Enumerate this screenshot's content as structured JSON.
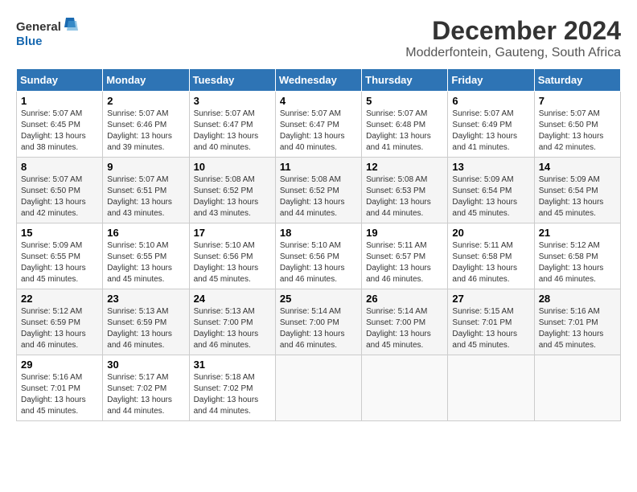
{
  "logo": {
    "line1": "General",
    "line2": "Blue"
  },
  "title": {
    "month_year": "December 2024",
    "location": "Modderfontein, Gauteng, South Africa"
  },
  "weekdays": [
    "Sunday",
    "Monday",
    "Tuesday",
    "Wednesday",
    "Thursday",
    "Friday",
    "Saturday"
  ],
  "weeks": [
    [
      {
        "day": "1",
        "sunrise": "5:07 AM",
        "sunset": "6:45 PM",
        "daylight": "13 hours and 38 minutes."
      },
      {
        "day": "2",
        "sunrise": "5:07 AM",
        "sunset": "6:46 PM",
        "daylight": "13 hours and 39 minutes."
      },
      {
        "day": "3",
        "sunrise": "5:07 AM",
        "sunset": "6:47 PM",
        "daylight": "13 hours and 40 minutes."
      },
      {
        "day": "4",
        "sunrise": "5:07 AM",
        "sunset": "6:47 PM",
        "daylight": "13 hours and 40 minutes."
      },
      {
        "day": "5",
        "sunrise": "5:07 AM",
        "sunset": "6:48 PM",
        "daylight": "13 hours and 41 minutes."
      },
      {
        "day": "6",
        "sunrise": "5:07 AM",
        "sunset": "6:49 PM",
        "daylight": "13 hours and 41 minutes."
      },
      {
        "day": "7",
        "sunrise": "5:07 AM",
        "sunset": "6:50 PM",
        "daylight": "13 hours and 42 minutes."
      }
    ],
    [
      {
        "day": "8",
        "sunrise": "5:07 AM",
        "sunset": "6:50 PM",
        "daylight": "13 hours and 42 minutes."
      },
      {
        "day": "9",
        "sunrise": "5:07 AM",
        "sunset": "6:51 PM",
        "daylight": "13 hours and 43 minutes."
      },
      {
        "day": "10",
        "sunrise": "5:08 AM",
        "sunset": "6:52 PM",
        "daylight": "13 hours and 43 minutes."
      },
      {
        "day": "11",
        "sunrise": "5:08 AM",
        "sunset": "6:52 PM",
        "daylight": "13 hours and 44 minutes."
      },
      {
        "day": "12",
        "sunrise": "5:08 AM",
        "sunset": "6:53 PM",
        "daylight": "13 hours and 44 minutes."
      },
      {
        "day": "13",
        "sunrise": "5:09 AM",
        "sunset": "6:54 PM",
        "daylight": "13 hours and 45 minutes."
      },
      {
        "day": "14",
        "sunrise": "5:09 AM",
        "sunset": "6:54 PM",
        "daylight": "13 hours and 45 minutes."
      }
    ],
    [
      {
        "day": "15",
        "sunrise": "5:09 AM",
        "sunset": "6:55 PM",
        "daylight": "13 hours and 45 minutes."
      },
      {
        "day": "16",
        "sunrise": "5:10 AM",
        "sunset": "6:55 PM",
        "daylight": "13 hours and 45 minutes."
      },
      {
        "day": "17",
        "sunrise": "5:10 AM",
        "sunset": "6:56 PM",
        "daylight": "13 hours and 45 minutes."
      },
      {
        "day": "18",
        "sunrise": "5:10 AM",
        "sunset": "6:56 PM",
        "daylight": "13 hours and 46 minutes."
      },
      {
        "day": "19",
        "sunrise": "5:11 AM",
        "sunset": "6:57 PM",
        "daylight": "13 hours and 46 minutes."
      },
      {
        "day": "20",
        "sunrise": "5:11 AM",
        "sunset": "6:58 PM",
        "daylight": "13 hours and 46 minutes."
      },
      {
        "day": "21",
        "sunrise": "5:12 AM",
        "sunset": "6:58 PM",
        "daylight": "13 hours and 46 minutes."
      }
    ],
    [
      {
        "day": "22",
        "sunrise": "5:12 AM",
        "sunset": "6:59 PM",
        "daylight": "13 hours and 46 minutes."
      },
      {
        "day": "23",
        "sunrise": "5:13 AM",
        "sunset": "6:59 PM",
        "daylight": "13 hours and 46 minutes."
      },
      {
        "day": "24",
        "sunrise": "5:13 AM",
        "sunset": "7:00 PM",
        "daylight": "13 hours and 46 minutes."
      },
      {
        "day": "25",
        "sunrise": "5:14 AM",
        "sunset": "7:00 PM",
        "daylight": "13 hours and 46 minutes."
      },
      {
        "day": "26",
        "sunrise": "5:14 AM",
        "sunset": "7:00 PM",
        "daylight": "13 hours and 45 minutes."
      },
      {
        "day": "27",
        "sunrise": "5:15 AM",
        "sunset": "7:01 PM",
        "daylight": "13 hours and 45 minutes."
      },
      {
        "day": "28",
        "sunrise": "5:16 AM",
        "sunset": "7:01 PM",
        "daylight": "13 hours and 45 minutes."
      }
    ],
    [
      {
        "day": "29",
        "sunrise": "5:16 AM",
        "sunset": "7:01 PM",
        "daylight": "13 hours and 45 minutes."
      },
      {
        "day": "30",
        "sunrise": "5:17 AM",
        "sunset": "7:02 PM",
        "daylight": "13 hours and 44 minutes."
      },
      {
        "day": "31",
        "sunrise": "5:18 AM",
        "sunset": "7:02 PM",
        "daylight": "13 hours and 44 minutes."
      },
      null,
      null,
      null,
      null
    ]
  ]
}
